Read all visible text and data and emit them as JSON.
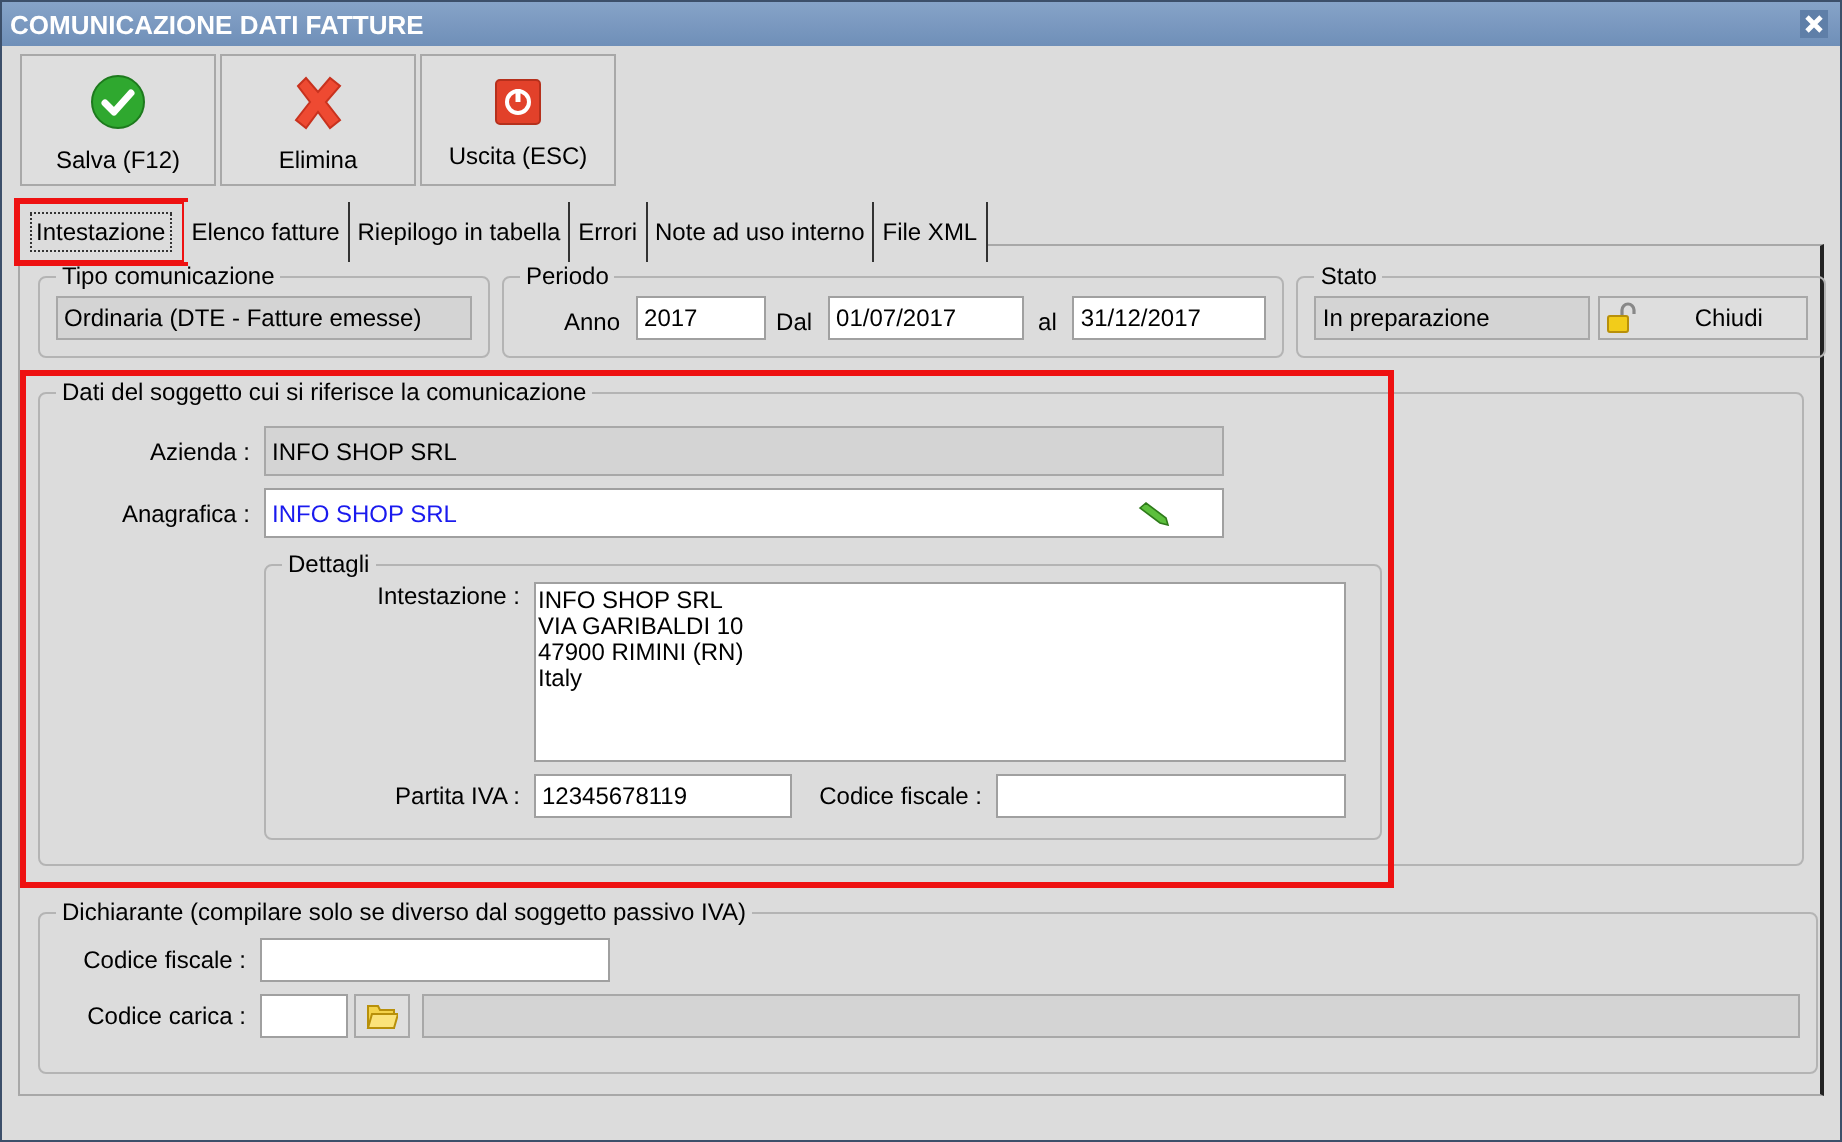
{
  "window": {
    "title": "COMUNICAZIONE DATI FATTURE"
  },
  "toolbar": [
    {
      "label": "Salva (F12)",
      "kind": "save"
    },
    {
      "label": "Elimina",
      "kind": "delete"
    },
    {
      "label": "Uscita (ESC)",
      "kind": "exit"
    }
  ],
  "tabs": [
    {
      "label": "Intestazione",
      "selected": true,
      "highlighted": true
    },
    {
      "label": "Elenco fatture",
      "selected": false,
      "highlighted": false
    },
    {
      "label": "Riepilogo in tabella",
      "selected": false,
      "highlighted": false
    },
    {
      "label": "Errori",
      "selected": false,
      "highlighted": false
    },
    {
      "label": "Note ad uso interno",
      "selected": false,
      "highlighted": false
    },
    {
      "label": "File XML",
      "selected": false,
      "highlighted": false
    }
  ],
  "tipo_comunicazione": {
    "title": "Tipo comunicazione",
    "value": "Ordinaria (DTE - Fatture emesse)",
    "disabled": true
  },
  "periodo": {
    "title": "Periodo",
    "fields": [
      {
        "label": "Anno",
        "value": "2017"
      },
      {
        "label": "Dal",
        "value": "01/07/2017"
      },
      {
        "label": "al",
        "value": "31/12/2017"
      }
    ]
  },
  "stato": {
    "title": "Stato",
    "value": "In preparazione",
    "disabled": true,
    "button": "Chiudi"
  },
  "soggetto": {
    "title": "Dati del soggetto cui si riferisce la comunicazione",
    "highlighted": true,
    "azienda": {
      "label": "Azienda :",
      "value": "INFO SHOP SRL",
      "disabled": true
    },
    "anagrafica": {
      "label": "Anagrafica :",
      "value": "INFO SHOP SRL",
      "disabled": false
    },
    "dettagli": {
      "title": "Dettagli",
      "intestazione": {
        "label": "Intestazione :",
        "lines": [
          "INFO SHOP SRL",
          "VIA GARIBALDI 10",
          "47900 RIMINI (RN)",
          "Italy"
        ]
      },
      "partita_iva": {
        "label": "Partita IVA :",
        "value": "12345678119"
      },
      "codice_fiscale": {
        "label": "Codice fiscale :"
      }
    }
  },
  "dichiarante": {
    "title": "Dichiarante (compilare solo se diverso dal soggetto passivo IVA)",
    "codice_fiscale": {
      "label": "Codice fiscale :"
    },
    "codice_carica": {
      "label": "Codice carica :",
      "description_disabled": true
    }
  }
}
